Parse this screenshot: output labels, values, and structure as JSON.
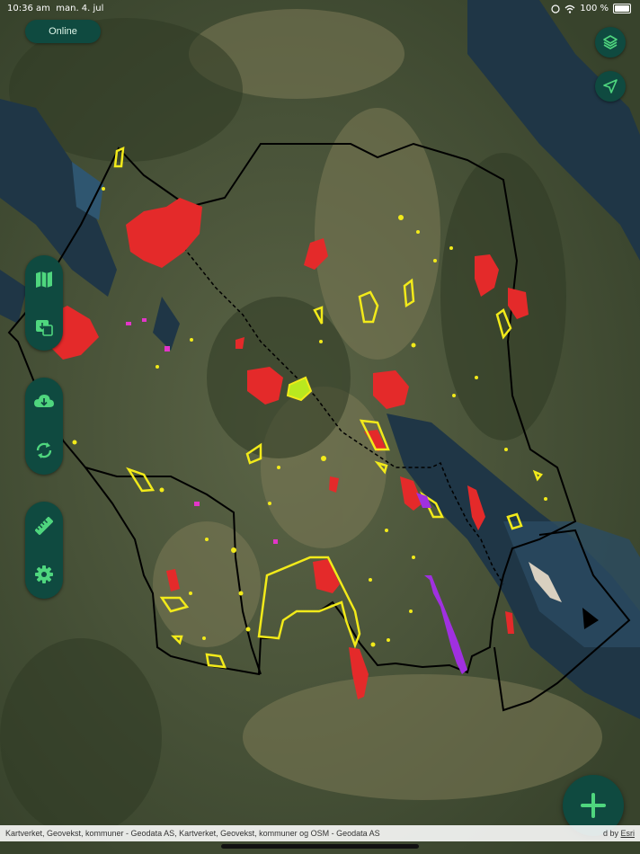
{
  "status_bar": {
    "time": "10:36 am",
    "date": "man. 4. jul",
    "battery": "100 %"
  },
  "connection": {
    "label": "Online"
  },
  "map_controls": {
    "layers_icon": "layers-icon",
    "locate_icon": "navigation-arrow-icon",
    "tools_group_1": [
      "map-icon",
      "map-download-icon"
    ],
    "tools_group_2": [
      "cloud-download-icon",
      "sync-icon"
    ],
    "tools_group_3": [
      "ruler-icon",
      "gear-icon"
    ],
    "add_icon": "plus-icon"
  },
  "attribution": {
    "text": "Kartverket, Geovekst, kommuner - Geodata AS, Kartverket, Geovekst, kommuner og OSM - Geodata AS",
    "powered_prefix": "d by ",
    "powered_link": "Esri"
  },
  "colors": {
    "accent": "#0f4a40",
    "accent_icon": "#4fd67e",
    "area_red": "#e42a2a",
    "area_yellow": "#f2ea1a",
    "area_magenta": "#e335c9",
    "area_purple": "#a030e0",
    "boundary": "#000000",
    "water": "#1f3646"
  }
}
